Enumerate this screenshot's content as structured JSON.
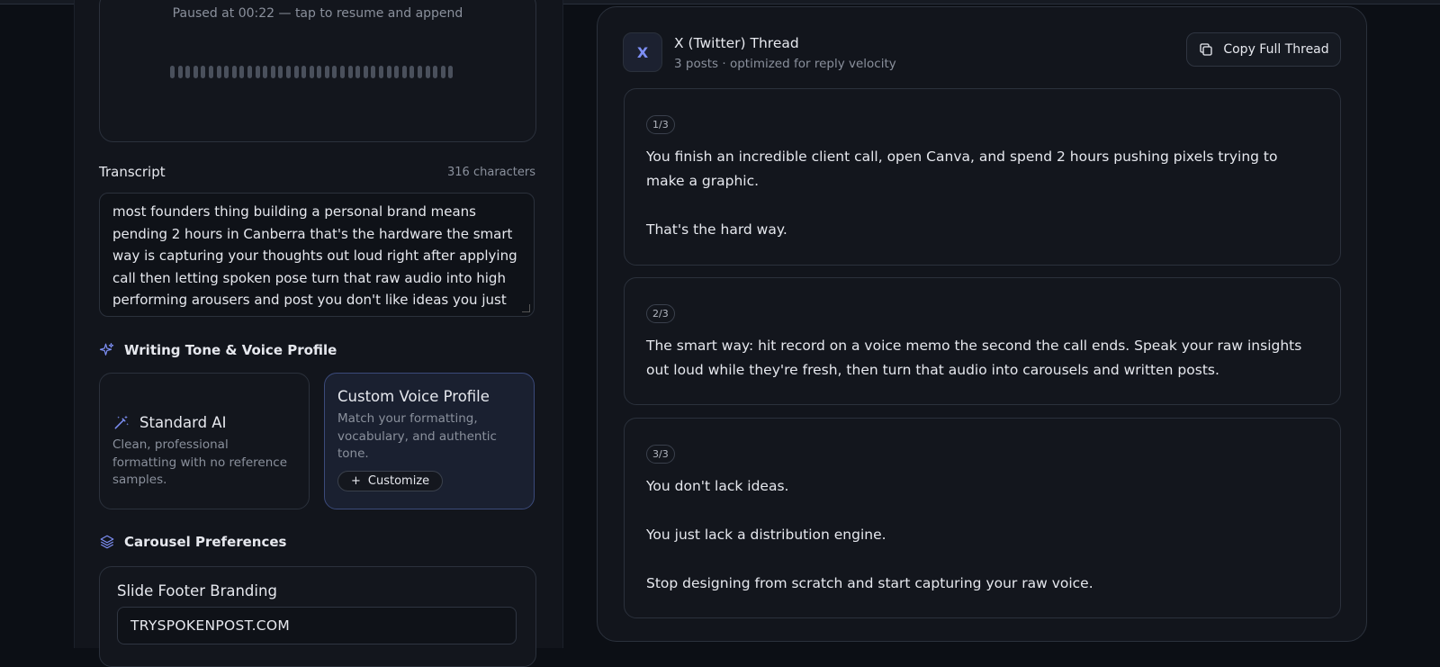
{
  "recorder": {
    "status": "Paused at 00:22 — tap to resume and append"
  },
  "transcript": {
    "label": "Transcript",
    "count": "316 characters",
    "text": "most founders thing building a personal brand means pending 2 hours in Canberra that's the hardware the smart way is capturing your thoughts out loud right after applying call then letting spoken pose turn that raw audio into high performing arousers and post you don't like ideas you just like a distribution engine"
  },
  "tone": {
    "heading": "Writing Tone & Voice Profile",
    "standard": {
      "title": "Standard AI",
      "desc": "Clean, professional formatting with no reference samples."
    },
    "custom": {
      "title": "Custom Voice Profile",
      "desc": "Match your formatting, vocabulary, and authentic tone.",
      "button": "Customize"
    }
  },
  "carousel": {
    "heading": "Carousel Preferences",
    "footer_label": "Slide Footer Branding",
    "footer_value": "TRYSPOKENPOST.COM"
  },
  "thread": {
    "badge": "X",
    "title": "X (Twitter) Thread",
    "subtitle": "3 posts · optimized for reply velocity",
    "copy_label": "Copy Full Thread",
    "posts": [
      {
        "index": "1/3",
        "text": "You finish an incredible client call, open Canva, and spend 2 hours pushing pixels trying to make a graphic.\n\nThat's the hard way."
      },
      {
        "index": "2/3",
        "text": "The smart way: hit record on a voice memo the second the call ends. Speak your raw insights out loud while they're fresh, then turn that audio into carousels and written posts."
      },
      {
        "index": "3/3",
        "text": "You don't lack ideas.\n\nYou just lack a distribution engine.\n\nStop designing from scratch and start capturing your raw voice."
      }
    ]
  },
  "colors": {
    "background": "#0c0f15",
    "panel": "#12151c",
    "accent": "#7d8ff5",
    "selected_card": "#1a2030"
  }
}
